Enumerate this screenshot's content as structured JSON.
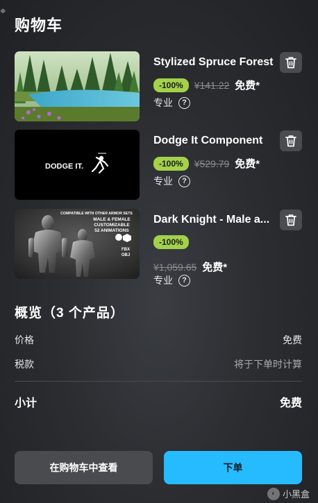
{
  "header": {
    "title": "购物车",
    "corner_glyph": "≑"
  },
  "cart_items": [
    {
      "name": "Stylized Spruce Forest",
      "discount": "-100%",
      "original_price": "¥141.22",
      "price": "免费*",
      "tier": "专业",
      "thumbnail_icon": "spruce-forest-thumbnail"
    },
    {
      "name": "Dodge It Component",
      "discount": "-100%",
      "original_price": "¥529.79",
      "price": "免费*",
      "tier": "专业",
      "thumbnail_icon": "dodge-it-thumbnail",
      "thumbnail_text": "DODGE IT."
    },
    {
      "name": "Dark Knight - Male a...",
      "discount": "-100%",
      "original_price": "¥1,059.65",
      "price": "免费*",
      "tier": "专业",
      "thumbnail_icon": "dark-knight-thumbnail",
      "thumbnail_lines": [
        "COMPATIBLE WITH OTHER ARMOR SETS",
        "MALE & FEMALE",
        "CUSTOMIZABLE",
        "52 ANIMATIONS"
      ],
      "thumbnail_formats": [
        "FBX",
        "OBJ"
      ]
    }
  ],
  "summary": {
    "title": "概览（3 个产品）",
    "price_label": "价格",
    "price_value": "免费",
    "tax_label": "税款",
    "tax_value": "将于下单时计算",
    "subtotal_label": "小计",
    "subtotal_value": "免费"
  },
  "actions": {
    "view_cart": "在购物车中查看",
    "place_order": "下单"
  },
  "watermark": {
    "text": "小黑盒"
  },
  "colors": {
    "accent": "#26bbff",
    "badge": "#a3d149",
    "secondary_button": "#4a4b4f"
  }
}
